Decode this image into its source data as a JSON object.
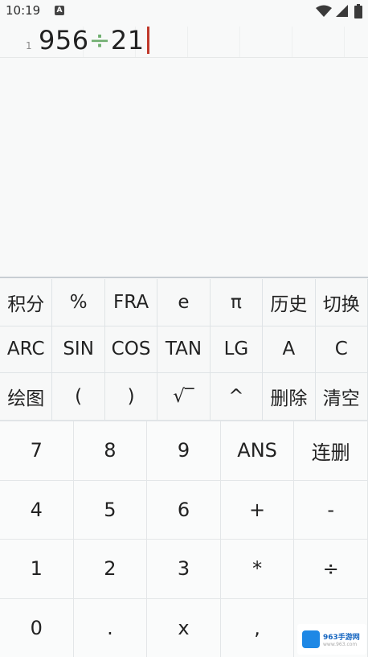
{
  "status_bar": {
    "time": "10:19",
    "badge": "A"
  },
  "editor": {
    "line_number": "1",
    "expression_left": "956",
    "operator": "÷",
    "expression_right": "21"
  },
  "function_keys": [
    [
      "积分",
      "%",
      "FRA",
      "e",
      "π",
      "历史",
      "切换"
    ],
    [
      "ARC",
      "SIN",
      "COS",
      "TAN",
      "LG",
      "A",
      "C"
    ],
    [
      "绘图",
      "(",
      ")",
      "√‾",
      "^",
      "删除",
      "清空"
    ]
  ],
  "number_keys": [
    [
      "7",
      "8",
      "9",
      "ANS",
      "连删"
    ],
    [
      "4",
      "5",
      "6",
      "+",
      "-"
    ],
    [
      "1",
      "2",
      "3",
      "*",
      "÷"
    ],
    [
      "0",
      ".",
      "x",
      ",",
      ""
    ]
  ],
  "watermark": {
    "brand": "963手游网",
    "sub": "www.963.com"
  },
  "colors": {
    "operator": "#6fae6f",
    "cursor": "#c0392b",
    "divider": "#c8ced4"
  }
}
